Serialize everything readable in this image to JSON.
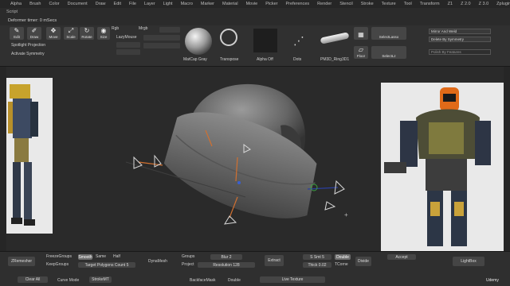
{
  "menu": [
    "Alpha",
    "Brush",
    "Color",
    "Document",
    "Draw",
    "Edit",
    "File",
    "Layer",
    "Light",
    "Macro",
    "Marker",
    "Material",
    "Movie",
    "Picker",
    "Preferences",
    "Render",
    "Stencil",
    "Stroke",
    "Texture",
    "Tool",
    "Transform",
    "Z1",
    "Z 2.0",
    "Z 3.0",
    "Zplugin"
  ],
  "sub": {
    "script": "Script",
    "deformer_timer": "Deformer timer: 0 mSecs"
  },
  "toolbar": {
    "edit": "Edit",
    "draw": "Draw",
    "move": "Move",
    "scale": "Scale",
    "rotate": "Rotate",
    "size": "Size",
    "spotlight": "Spotlight Projection",
    "activate_symmetry": "Activate Symmetry",
    "lazymouse": "LazyMouse",
    "lazy_step": "Lazy Step",
    "lazy_radius": "Lazy Radius",
    "rgb_label": "Rgb",
    "m_label": "M",
    "mrgb_label": "Mrgb",
    "zadd_label": "Zadd",
    "zsub_label": "Zsub",
    "focal_shift": "Focal Shift",
    "draw_size": "Draw Size",
    "z_intensity": "Z Intensity",
    "matcap": "MatCap Gray",
    "transpose": "Transpose",
    "alpha": "Alpha Off",
    "dots": "Dots",
    "brush_name": "PM3D_Ring3D1",
    "floor": "Floor",
    "persp": "Persp",
    "select_lasso": "SelectLasso",
    "select_rect": "SelectLasso Rect",
    "selectlz": "SelectLz",
    "dd1": "Mirror And Weld",
    "dd2": "Delete By Symmetry",
    "dd3": "Polish By Features",
    "x_label": "X",
    "y_label": "Y",
    "z_label": "Z"
  },
  "canvas": {
    "bg": "#2a2a2a",
    "cursor_glyph": "+"
  },
  "bottom": {
    "zremesher": "ZRemesher",
    "freezegroups": "FreezeGroups",
    "smooth": "Smooth",
    "same": "Same",
    "half": "Half",
    "keepgroups": "KeepGroups",
    "target_poly": "Target Polygons Count 5",
    "dynamesh": "DynaMesh",
    "groups": "Groups",
    "blur": "Blur 2",
    "project": "Project",
    "resolution": "Resolution 128",
    "extract": "Extract",
    "s_smt": "S Smt 5",
    "thick": "Thick 0.02",
    "double": "Double",
    "tcorne": "TCorne",
    "accept": "Accept",
    "divide": "Divide",
    "lightbox": "LightBox",
    "clear_all": "Clear All",
    "curve_mode": "Curve Mode",
    "stroke_mt": "StrokeMT",
    "backface": "BackfaceMask",
    "double2": "Double",
    "live_texture": "Live Texture",
    "udemy": "Udemy"
  }
}
